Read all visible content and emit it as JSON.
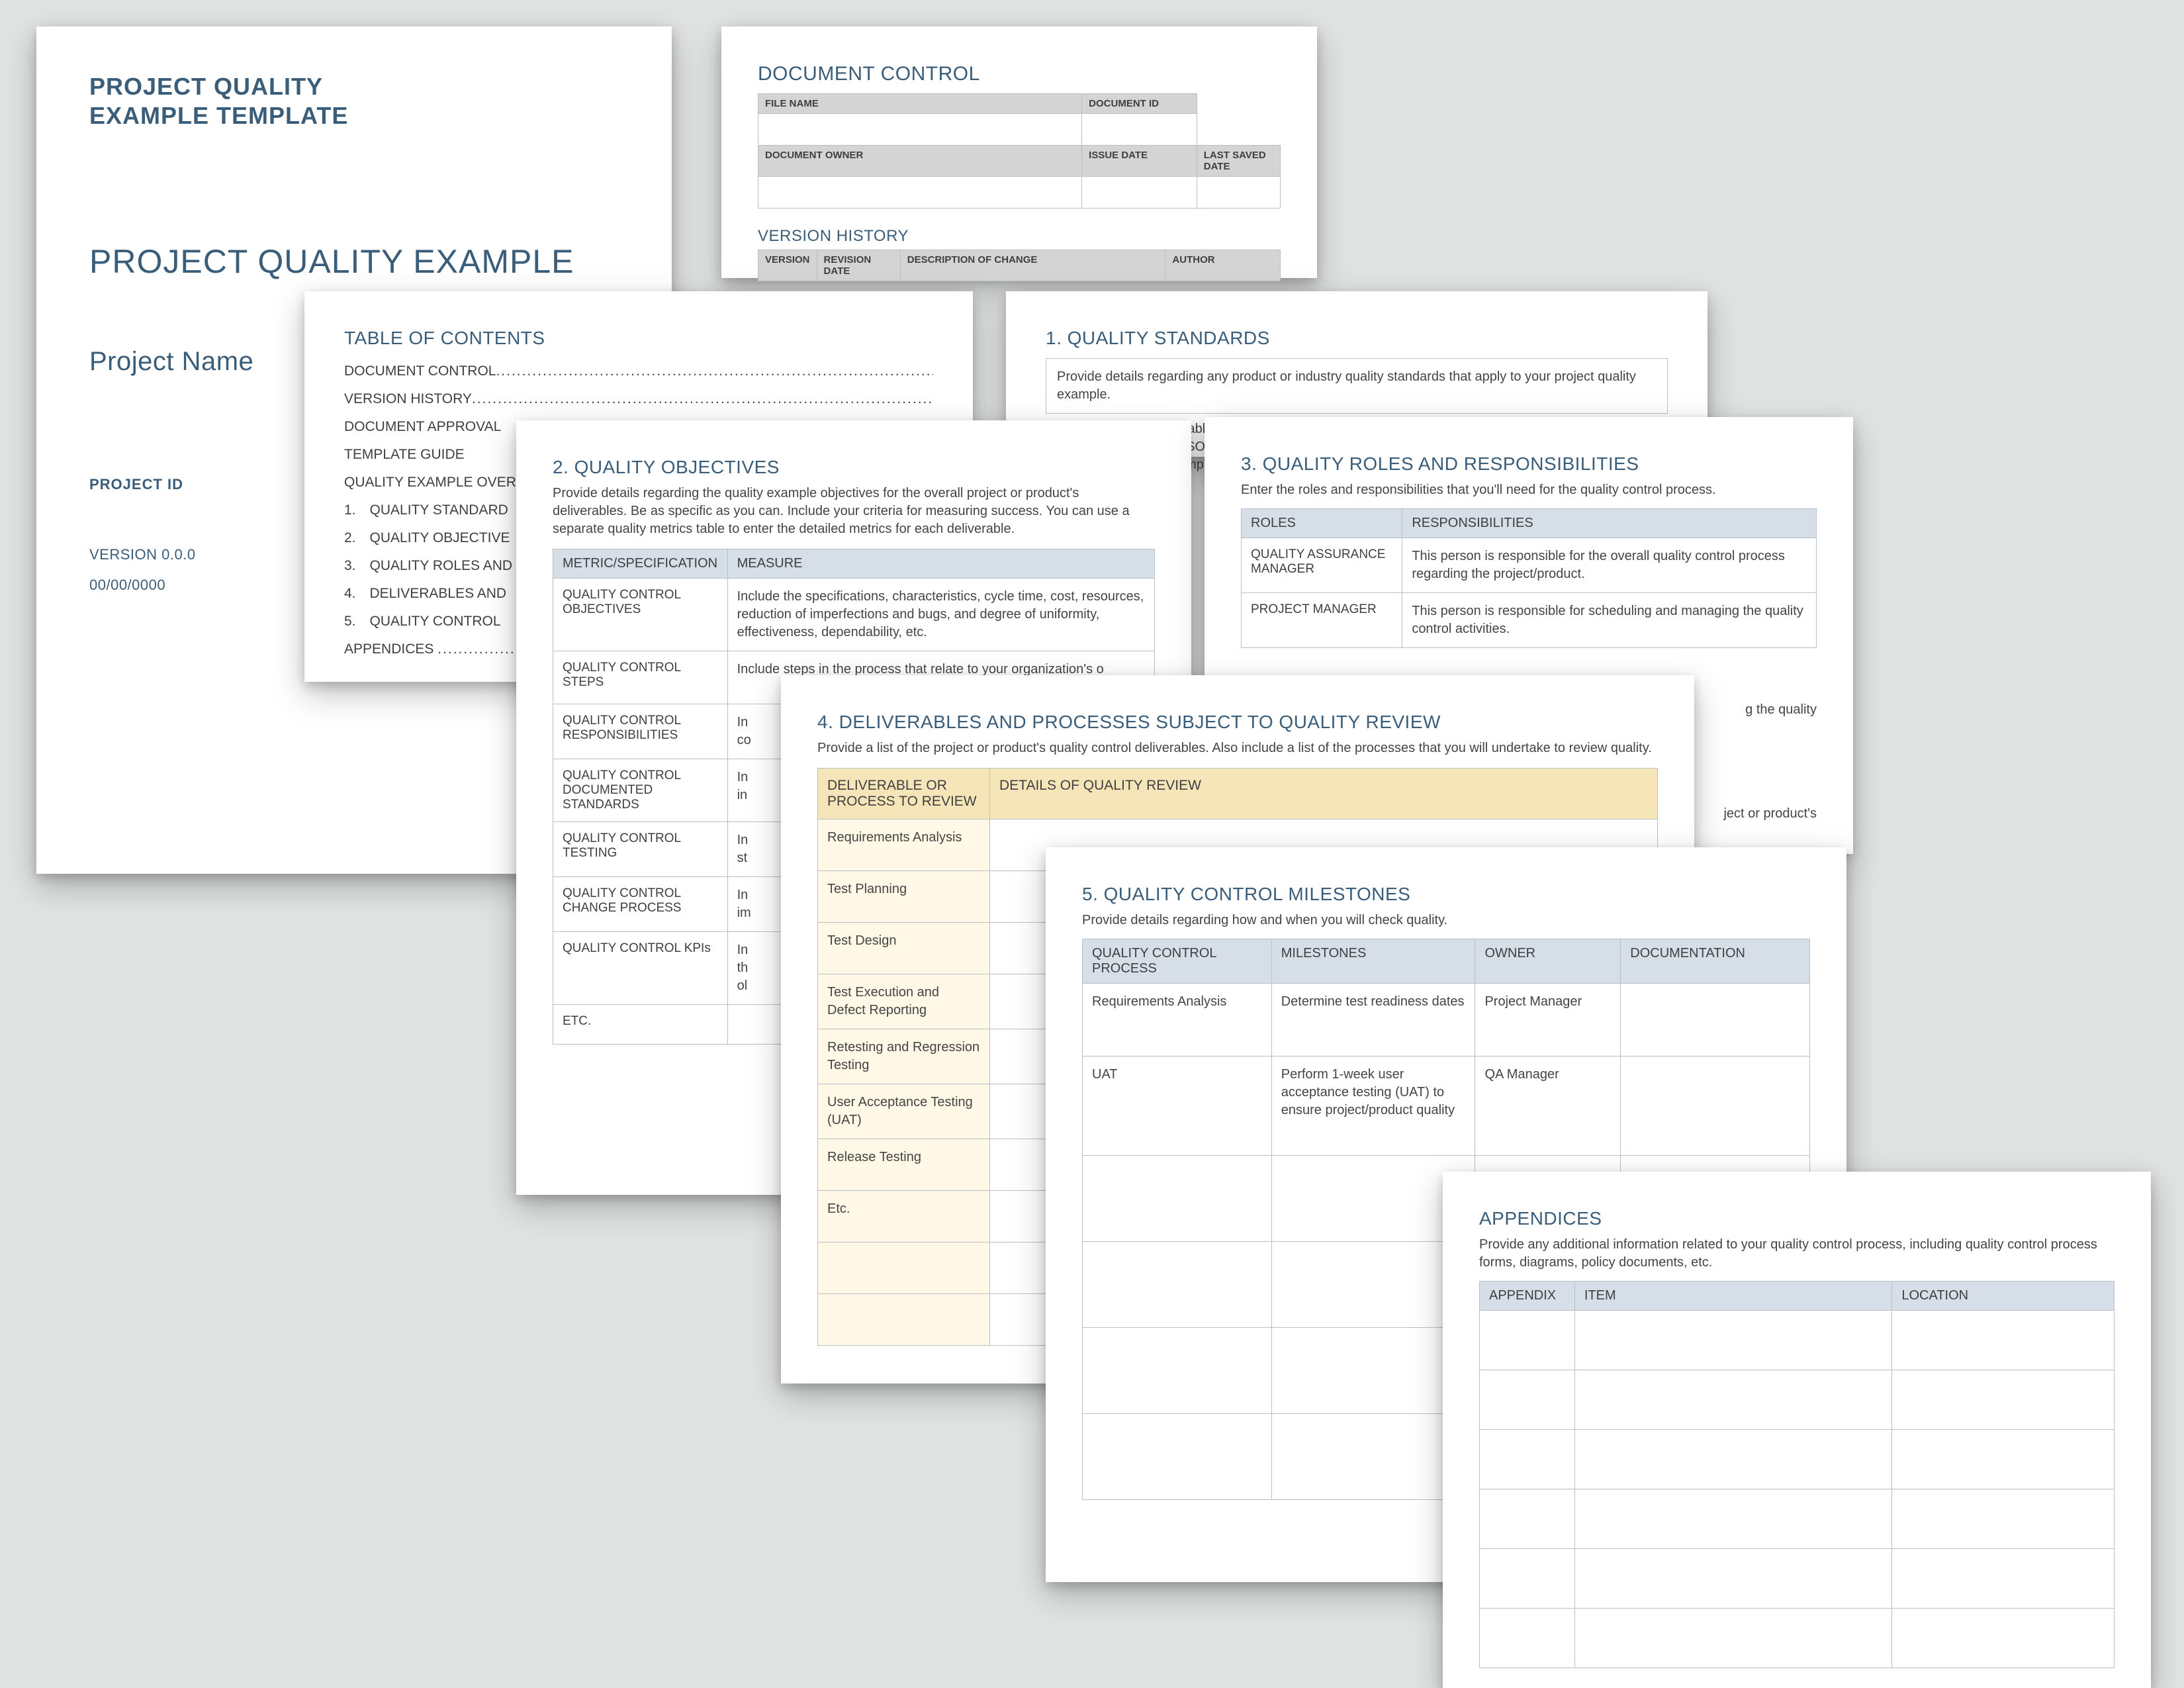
{
  "cover": {
    "template_line1": "PROJECT QUALITY",
    "template_line2": "EXAMPLE TEMPLATE",
    "doc_title": "PROJECT QUALITY EXAMPLE",
    "project_name": "Project Name",
    "project_id_label": "PROJECT ID",
    "version": "VERSION 0.0.0",
    "date": "00/00/0000"
  },
  "doc_control": {
    "heading": "DOCUMENT CONTROL",
    "file_name": "FILE NAME",
    "document_id": "DOCUMENT ID",
    "document_owner": "DOCUMENT OWNER",
    "issue_date": "ISSUE DATE",
    "last_saved": "LAST SAVED DATE",
    "version_history": "VERSION HISTORY",
    "vh_version": "VERSION",
    "vh_rev_date": "REVISION DATE",
    "vh_desc": "DESCRIPTION OF CHANGE",
    "vh_author": "AUTHOR"
  },
  "toc": {
    "heading": "TABLE OF CONTENTS",
    "lines": [
      "DOCUMENT CONTROL",
      "VERSION HISTORY",
      "DOCUMENT APPROVAL",
      "TEMPLATE GUIDE",
      "QUALITY EXAMPLE OVER",
      "1. QUALITY STANDARD",
      "2. QUALITY OBJECTIVE",
      "3. QUALITY ROLES AND",
      "4. DELIVERABLES AND",
      "5. QUALITY CONTROL",
      "APPENDICES"
    ]
  },
  "s1": {
    "heading": "1.  QUALITY STANDARDS",
    "intro": "Provide details regarding any product or industry quality standards that apply to your project quality example.",
    "frag1": "icable",
    "frag2": "(ISO) a",
    "frag3": "ompa"
  },
  "s2": {
    "heading": "2.  QUALITY OBJECTIVES",
    "intro": "Provide details regarding the quality example objectives for the overall project or product's deliverables. Be as specific as you can. Include your criteria for measuring success. You can use a separate quality metrics table to enter the detailed metrics for each deliverable.",
    "th_metric": "METRIC/SPECIFICATION",
    "th_measure": "MEASURE",
    "rows": [
      {
        "m": "QUALITY CONTROL OBJECTIVES",
        "d": "Include the specifications, characteristics, cycle time, cost, resources, reduction of imperfections and bugs, and degree of uniformity, effectiveness, dependability, etc."
      },
      {
        "m": "QUALITY CONTROL STEPS",
        "d": "Include steps in the process that relate to your organization's o"
      },
      {
        "m": "QUALITY CONTROL RESPONSIBILITIES",
        "d": "In\nco"
      },
      {
        "m": "QUALITY CONTROL DOCUMENTED STANDARDS",
        "d": "In\nin"
      },
      {
        "m": "QUALITY CONTROL TESTING",
        "d": "In\nst"
      },
      {
        "m": "QUALITY CONTROL CHANGE PROCESS",
        "d": "In\nim"
      },
      {
        "m": "QUALITY CONTROL KPIs",
        "d": "In\nth\nol"
      },
      {
        "m": "ETC.",
        "d": ""
      }
    ]
  },
  "s3": {
    "heading": "3.  QUALITY ROLES AND RESPONSIBILITIES",
    "intro": "Enter the roles and responsibilities that you'll need for the quality control process.",
    "th_roles": "ROLES",
    "th_resp": "RESPONSIBILITIES",
    "rows": [
      {
        "r": "QUALITY ASSURANCE MANAGER",
        "d": "This person is responsible for the overall quality control process regarding the project/product."
      },
      {
        "r": "PROJECT MANAGER",
        "d": "This person is responsible for scheduling and managing the quality control activities."
      }
    ],
    "frag1": "g the quality",
    "frag2": "ject or product's"
  },
  "s4": {
    "heading": "4.   DELIVERABLES AND PROCESSES SUBJECT TO QUALITY REVIEW",
    "intro": "Provide a list of the project or product's quality control deliverables. Also include a list of the processes that you will undertake to review quality.",
    "th_left": "DELIVERABLE OR PROCESS TO REVIEW",
    "th_right": "DETAILS OF QUALITY REVIEW",
    "rows": [
      "Requirements Analysis",
      "Test Planning",
      "Test Design",
      "Test Execution and Defect Reporting",
      "Retesting and Regression Testing",
      "User Acceptance Testing (UAT)",
      "Release Testing",
      "Etc."
    ]
  },
  "s5": {
    "heading": "5.  QUALITY CONTROL MILESTONES",
    "intro": "Provide details regarding how and when you will check quality.",
    "th1": "QUALITY CONTROL PROCESS",
    "th2": "MILESTONES",
    "th3": "OWNER",
    "th4": "DOCUMENTATION",
    "rows": [
      {
        "p": "Requirements Analysis",
        "m": "Determine test readiness dates",
        "o": "Project Manager",
        "d": ""
      },
      {
        "p": "UAT",
        "m": "Perform 1-week user acceptance testing (UAT) to ensure project/product quality",
        "o": "QA Manager",
        "d": ""
      },
      {
        "p": "",
        "m": "",
        "o": "",
        "d": ""
      },
      {
        "p": "",
        "m": "",
        "o": "",
        "d": ""
      },
      {
        "p": "",
        "m": "",
        "o": "",
        "d": ""
      },
      {
        "p": "",
        "m": "",
        "o": "",
        "d": ""
      }
    ]
  },
  "appx": {
    "heading": "APPENDICES",
    "intro": "Provide any additional information related to your quality control process, including quality control process forms, diagrams, policy documents, etc.",
    "th1": "APPENDIX",
    "th2": "ITEM",
    "th3": "LOCATION"
  }
}
